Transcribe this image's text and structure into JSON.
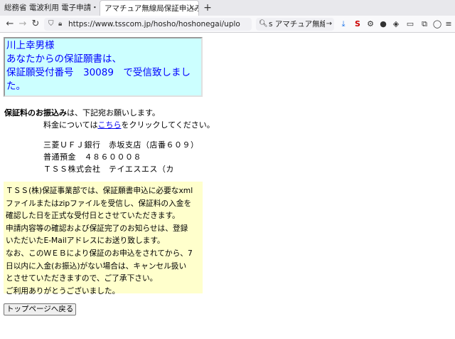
{
  "browser": {
    "tabs": [
      {
        "label": "総務省 電波利用 電子申請・届",
        "active": false
      },
      {
        "label": "アマチュア無線局保証申込み",
        "active": true
      }
    ],
    "url": "https://www.tsscom.jp/hosho/hoshonegai/uplo",
    "search_text": "s アマチュア無線",
    "icons": {
      "back": "back-arrow-icon",
      "forward": "forward-arrow-icon",
      "reload": "reload-icon",
      "new_tab": "plus-icon"
    }
  },
  "notice": {
    "lines": [
      "川上幸男様",
      "あなたからの保証願書は、",
      "保証願受付番号　30089　で受信致しまし",
      "た。"
    ],
    "color": "#0000ff",
    "background": "#ccffff"
  },
  "payment": {
    "intro_bold": "保証料のお振込み",
    "intro_rest": "は、下記宛お願いします。",
    "fee_prefix": "料金については",
    "fee_link": "こちら",
    "fee_suffix": "をクリックしてください。",
    "bank": [
      "三菱ＵＦＪ銀行　赤坂支店（店番６０９）",
      "普通預金　４８６０００８",
      "ＴＳＳ株式会社　テイエスエス（カ"
    ]
  },
  "info": {
    "background": "#ffffcc",
    "lines": [
      "ＴＳＳ(株)保証事業部では、保証願書申込に必要なxml",
      "ファイルまたはzipファイルを受信し、保証料の入金を",
      "確認した日を正式な受付日とさせていただきます。",
      "申請内容等の確認および保証完了のお知らせは、登録",
      "いただいたE-Mailアドレスにお送り致します。",
      "なお、このＷＥＢにより保証のお申込をされてから、7",
      "日以内に入金(お振込)がない場合は、キャンセル扱い",
      "とさせていただきますので、ご了承下さい。",
      "ご利用ありがとうございました。"
    ]
  },
  "buttons": {
    "top_page": "トップページへ戻る"
  }
}
